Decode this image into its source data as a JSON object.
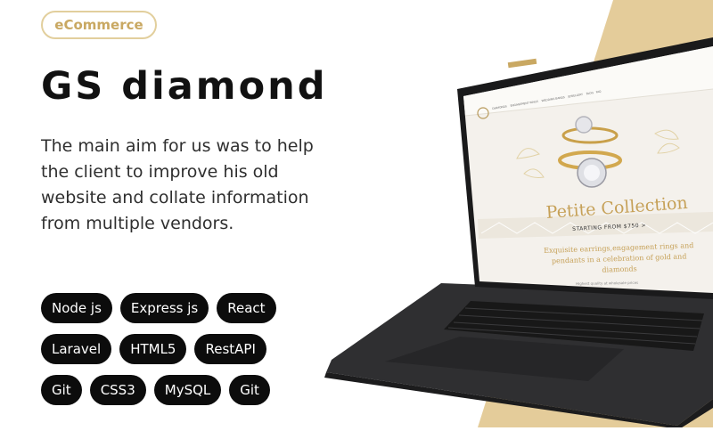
{
  "category": "eCommerce",
  "title": "GS diamond",
  "description": "The main aim for us was to help the client to improve his old website and collate information from multiple vendors.",
  "tech_rows": [
    [
      "Node js",
      "Express js",
      "React"
    ],
    [
      "Laravel",
      "HTML5",
      "RestAPI"
    ],
    [
      "Git",
      "CSS3",
      "MySQL",
      "Git"
    ]
  ],
  "colors": {
    "gold": "#e4cc9a",
    "badge_border": "#e2cf9d",
    "pill_bg": "#0c0c0c"
  },
  "screen": {
    "nav_items": [
      "DIAMONDS",
      "ENGAGEMENT RINGS",
      "WEDDING BANDS",
      "JEWELLERY",
      "BLOG",
      "FAQ"
    ],
    "hero_title": "Petite Collection",
    "hero_sub": "STARTING FROM $750 >",
    "tagline_lines": [
      "Exquisite earrings,engagement rings and",
      "pendants in a celebration of gold and",
      "diamonds"
    ],
    "footnote": "Highest quality at wholesale prices"
  }
}
